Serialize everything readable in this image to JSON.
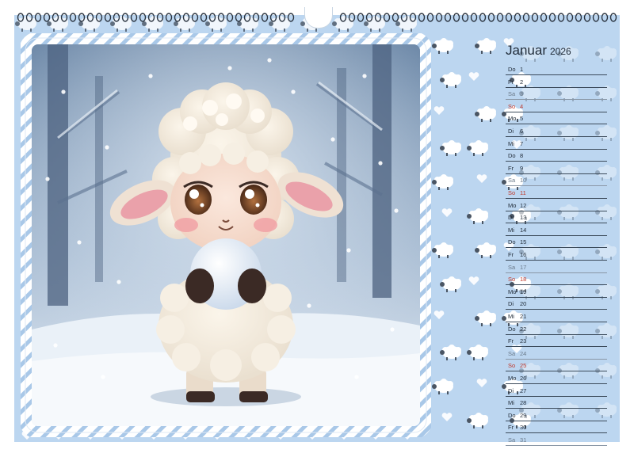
{
  "calendar": {
    "month": "Januar",
    "year": "2026",
    "days": [
      {
        "wd": "Do",
        "d": "1",
        "type": "wk"
      },
      {
        "wd": "Fr",
        "d": "2",
        "type": "wk"
      },
      {
        "wd": "Sa",
        "d": "3",
        "type": "sat"
      },
      {
        "wd": "So",
        "d": "4",
        "type": "sun"
      },
      {
        "wd": "Mo",
        "d": "5",
        "type": "wk"
      },
      {
        "wd": "Di",
        "d": "6",
        "type": "wk"
      },
      {
        "wd": "Mi",
        "d": "7",
        "type": "wk"
      },
      {
        "wd": "Do",
        "d": "8",
        "type": "wk"
      },
      {
        "wd": "Fr",
        "d": "9",
        "type": "wk"
      },
      {
        "wd": "Sa",
        "d": "10",
        "type": "sat"
      },
      {
        "wd": "So",
        "d": "11",
        "type": "sun"
      },
      {
        "wd": "Mo",
        "d": "12",
        "type": "wk"
      },
      {
        "wd": "Di",
        "d": "13",
        "type": "wk"
      },
      {
        "wd": "Mi",
        "d": "14",
        "type": "wk"
      },
      {
        "wd": "Do",
        "d": "15",
        "type": "wk"
      },
      {
        "wd": "Fr",
        "d": "16",
        "type": "wk"
      },
      {
        "wd": "Sa",
        "d": "17",
        "type": "sat"
      },
      {
        "wd": "So",
        "d": "18",
        "type": "sun"
      },
      {
        "wd": "Mo",
        "d": "19",
        "type": "wk"
      },
      {
        "wd": "Di",
        "d": "20",
        "type": "wk"
      },
      {
        "wd": "Mi",
        "d": "21",
        "type": "wk"
      },
      {
        "wd": "Do",
        "d": "22",
        "type": "wk"
      },
      {
        "wd": "Fr",
        "d": "23",
        "type": "wk"
      },
      {
        "wd": "Sa",
        "d": "24",
        "type": "sat"
      },
      {
        "wd": "So",
        "d": "25",
        "type": "sun"
      },
      {
        "wd": "Mo",
        "d": "26",
        "type": "wk"
      },
      {
        "wd": "Di",
        "d": "27",
        "type": "wk"
      },
      {
        "wd": "Mi",
        "d": "28",
        "type": "wk"
      },
      {
        "wd": "Do",
        "d": "29",
        "type": "wk"
      },
      {
        "wd": "Fr",
        "d": "30",
        "type": "wk"
      },
      {
        "wd": "Sa",
        "d": "31",
        "type": "sat"
      }
    ]
  },
  "illustration": {
    "subject": "lamb-holding-snowball-icon",
    "scene": "snowy-forest"
  },
  "colors": {
    "background": "#bcd6f0",
    "sunday": "#c0392b",
    "rope": "#ffffff",
    "rope_stripe": "#9fbfe0"
  }
}
